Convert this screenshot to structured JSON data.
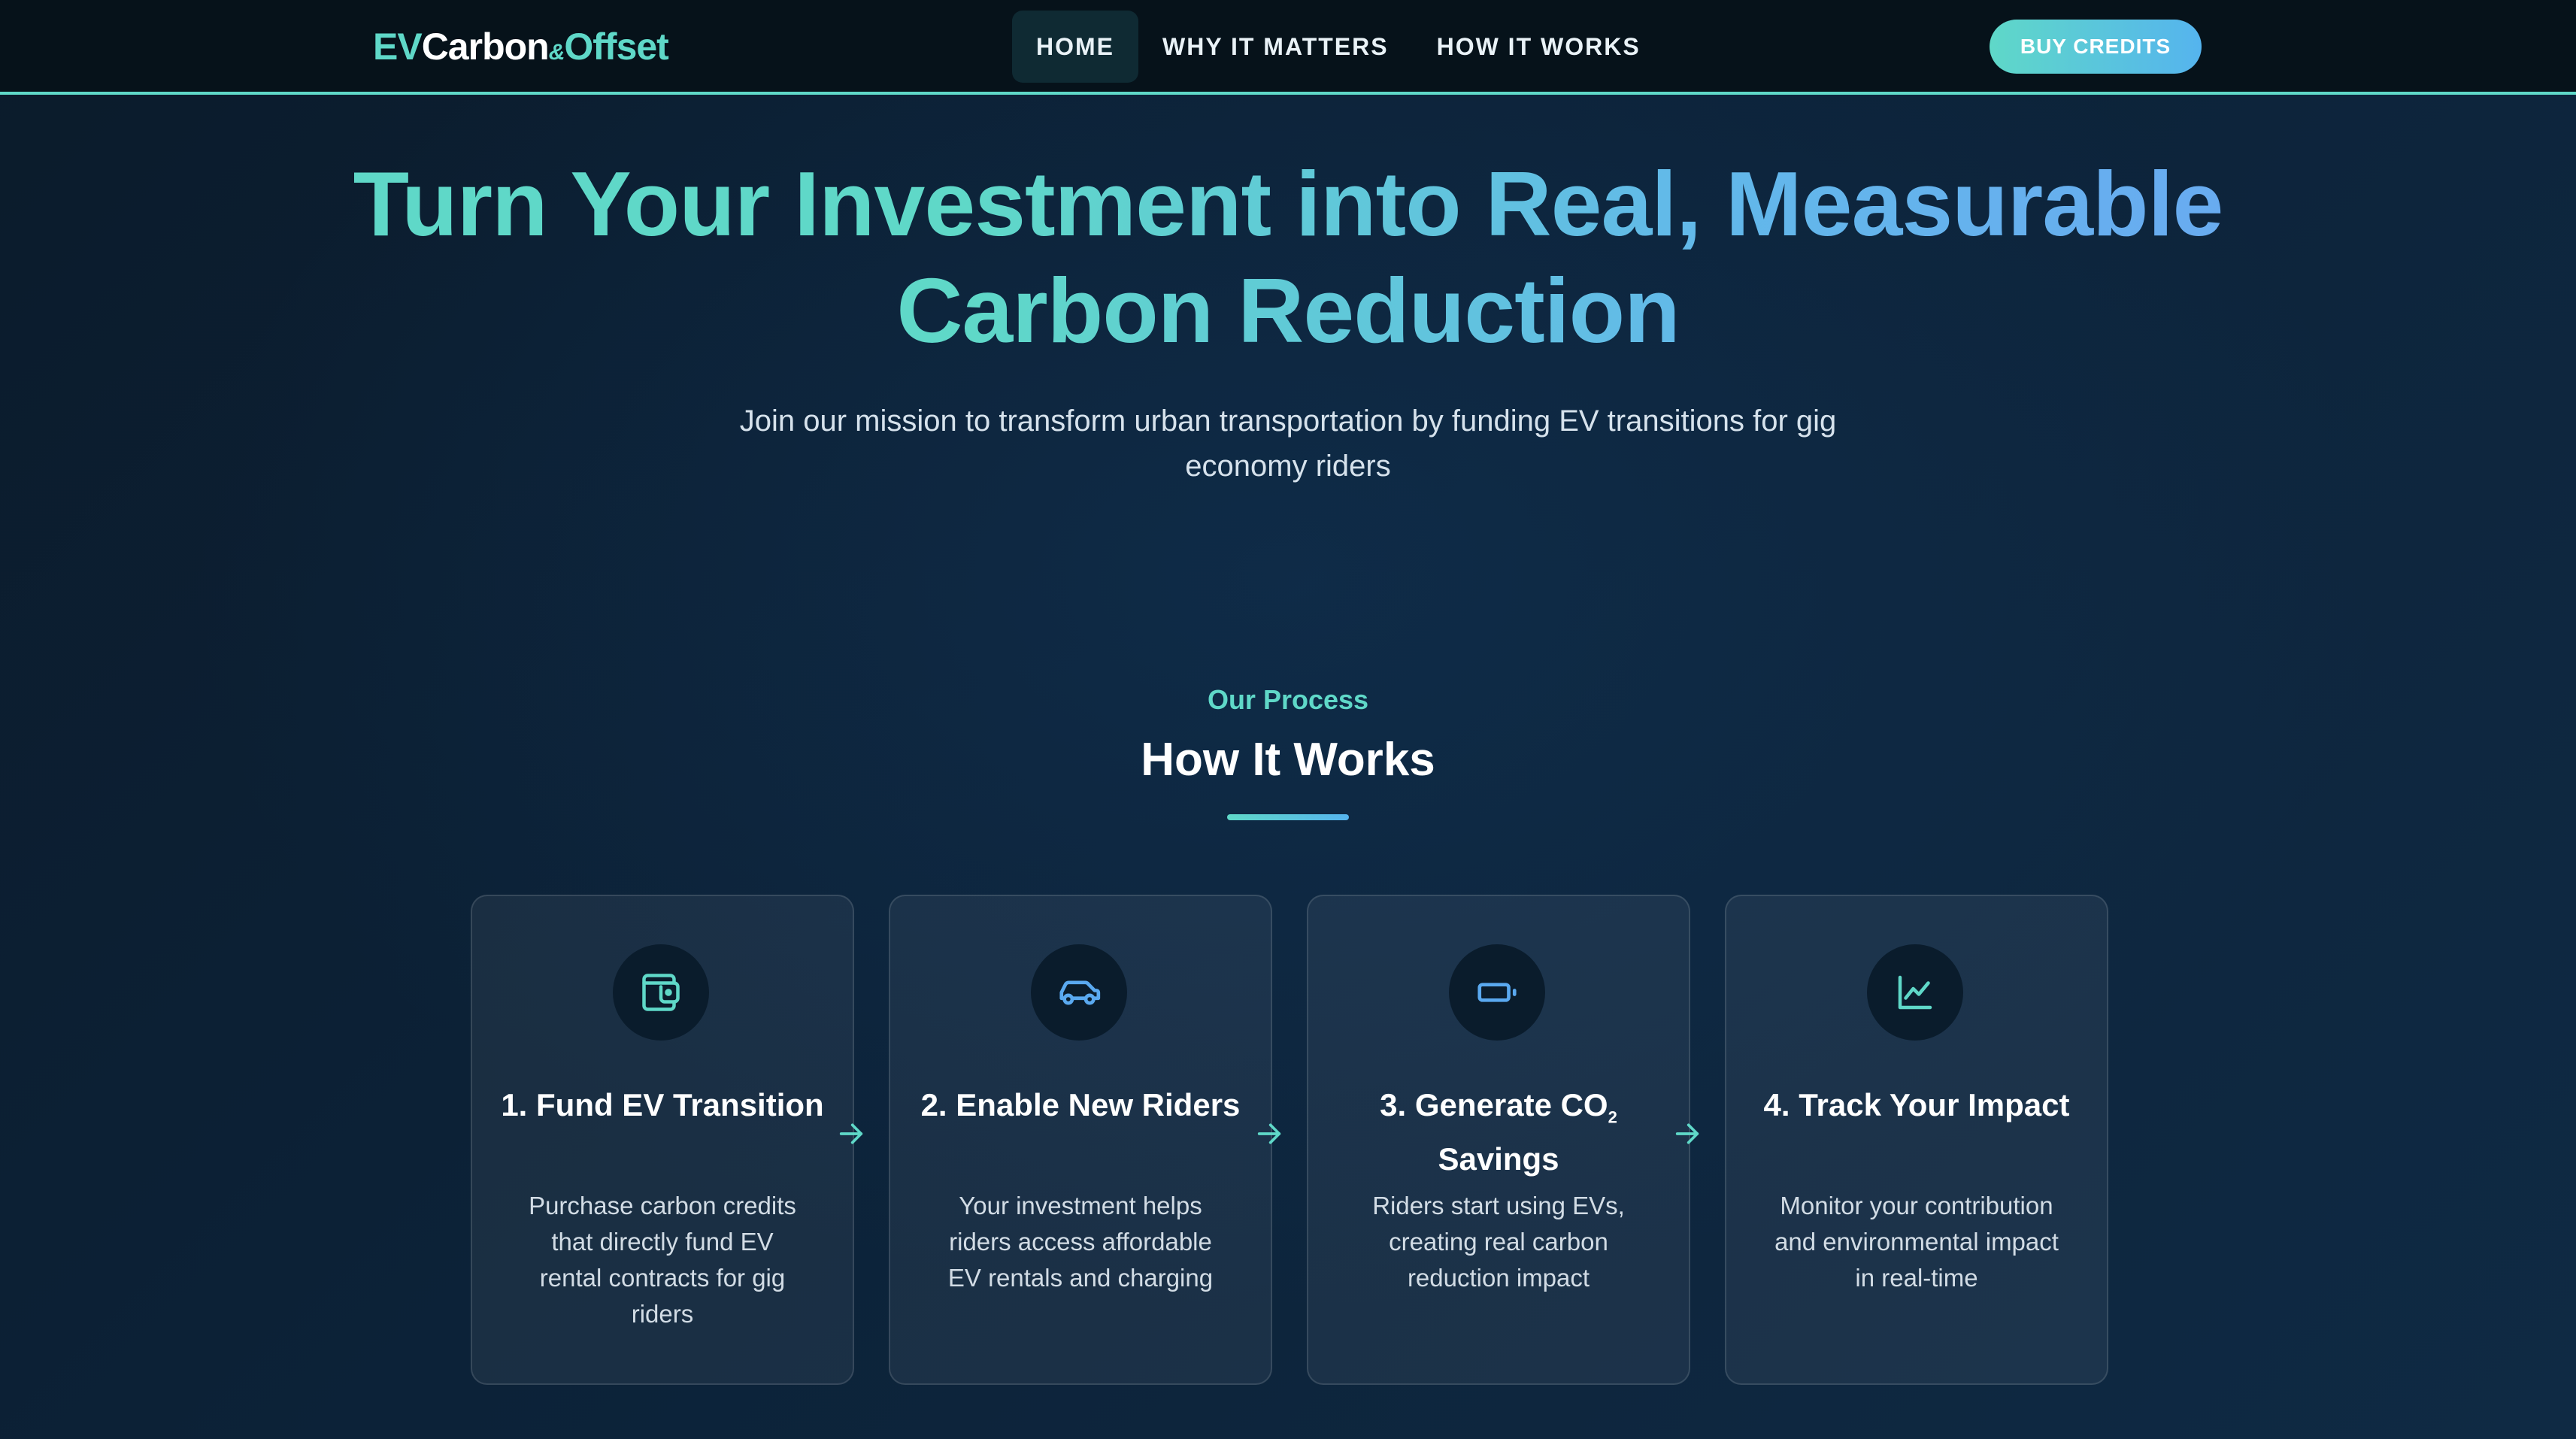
{
  "nav": {
    "logo": {
      "ev": "EV",
      "carbon": "Carbon",
      "amp": "&",
      "offset": "Offset"
    },
    "links": [
      {
        "label": "HOME",
        "active": true
      },
      {
        "label": "WHY IT MATTERS",
        "active": false
      },
      {
        "label": "HOW IT WORKS",
        "active": false
      }
    ],
    "cta": "BUY CREDITS"
  },
  "hero": {
    "title_line1": "Turn Your Investment into Real, Measurable",
    "title_line2": "Carbon Reduction",
    "subtitle": "Join our mission to transform urban transportation by funding EV transitions for gig economy riders"
  },
  "process": {
    "eyebrow": "Our Process",
    "title": "How It Works",
    "steps": [
      {
        "icon": "wallet-icon",
        "title": "1. Fund EV Transition",
        "desc": "Purchase carbon credits that directly fund EV rental contracts for gig riders"
      },
      {
        "icon": "car-icon",
        "title": "2. Enable New Riders",
        "desc": "Your investment helps riders access affordable EV rentals and charging"
      },
      {
        "icon": "battery-icon",
        "title_main": "3. Generate CO",
        "title_sub": "2",
        "title_end": "Savings",
        "desc": "Riders start using EVs, creating real carbon reduction impact"
      },
      {
        "icon": "chart-line-icon",
        "title": "4. Track Your Impact",
        "desc": "Monitor your contribution and environmental impact in real-time"
      }
    ]
  },
  "colors": {
    "accent": "#5fd8c8",
    "accent2": "#55b4ee",
    "background": "#0c2238"
  }
}
